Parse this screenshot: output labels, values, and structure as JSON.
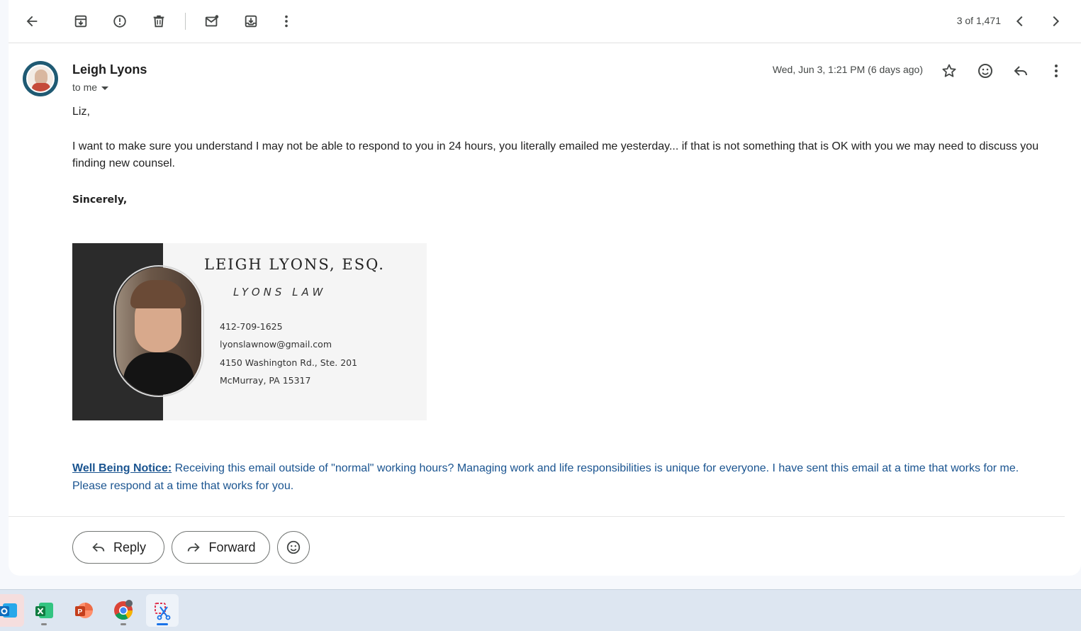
{
  "toolbar": {
    "icons": [
      "back-arrow-icon",
      "archive-icon",
      "report-spam-icon",
      "delete-icon",
      "mark-unread-icon",
      "move-to-icon",
      "more-vert-icon"
    ],
    "pager": "3 of 1,471"
  },
  "message": {
    "sender_name": "Leigh Lyons",
    "to_label": "to me",
    "date": "Wed, Jun 3, 1:21 PM (6 days ago)",
    "greeting": "Liz,",
    "paragraph": "I want to make sure you understand I may not be able to respond to you in 24 hours, you literally emailed me yesterday... if that is not something that is OK with you we may need to discuss you finding new counsel.",
    "closing": "Sincerely,"
  },
  "signature": {
    "name": "LEIGH LYONS, ESQ.",
    "firm": "LYONS LAW",
    "phone": "412-709-1625",
    "email": "lyonslawnow@gmail.com",
    "address1": "4150 Washington Rd., Ste. 201",
    "address2": "McMurray, PA 15317"
  },
  "notice": {
    "label": "Well Being Notice:",
    "text": " Receiving this email outside of \"normal\" working hours? Managing work and life responsibilities is unique for everyone. I have sent this email at a time that works for me. Please respond at a time that works for you."
  },
  "actions": {
    "reply": "Reply",
    "forward": "Forward"
  },
  "taskbar": {
    "apps": [
      "outlook-icon",
      "excel-icon",
      "powerpoint-icon",
      "chrome-icon",
      "snipping-tool-icon"
    ]
  },
  "colors": {
    "notice_blue": "#1a5490",
    "signature_dark": "#2b2b2b",
    "avatar_ring": "#1f5a73"
  }
}
